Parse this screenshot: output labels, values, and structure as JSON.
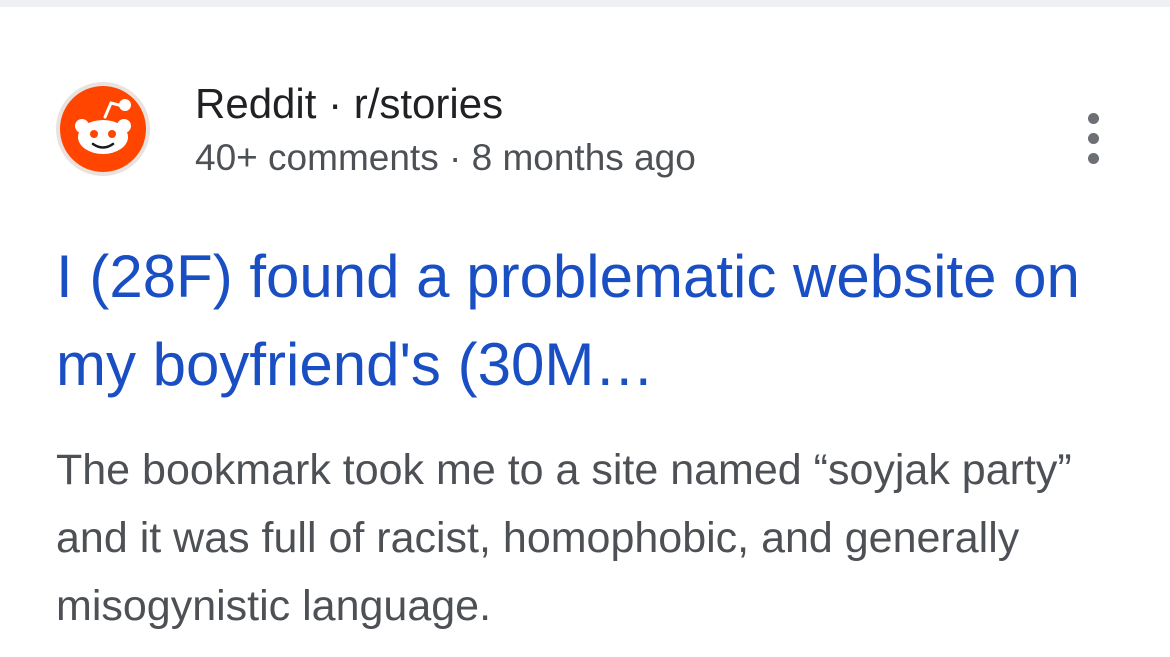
{
  "result": {
    "site_name": "Reddit",
    "separator": " · ",
    "community": "r/stories",
    "comment_count": "40+ comments",
    "age": "8 months ago",
    "title": "I (28F) found a problematic website on my boyfriend's (30M…",
    "snippet": "The bookmark took me to a site named “soyjak party” and it was full of racist, homophobic, and generally misogynistic language.",
    "avatar_icon": "reddit-logo-icon",
    "menu_icon": "more-vert-icon"
  },
  "colors": {
    "link": "#1a4fc4",
    "reddit_orange": "#ff4500",
    "text_primary": "#202124",
    "text_secondary": "#4d5156",
    "page_background": "#eef0f4"
  }
}
